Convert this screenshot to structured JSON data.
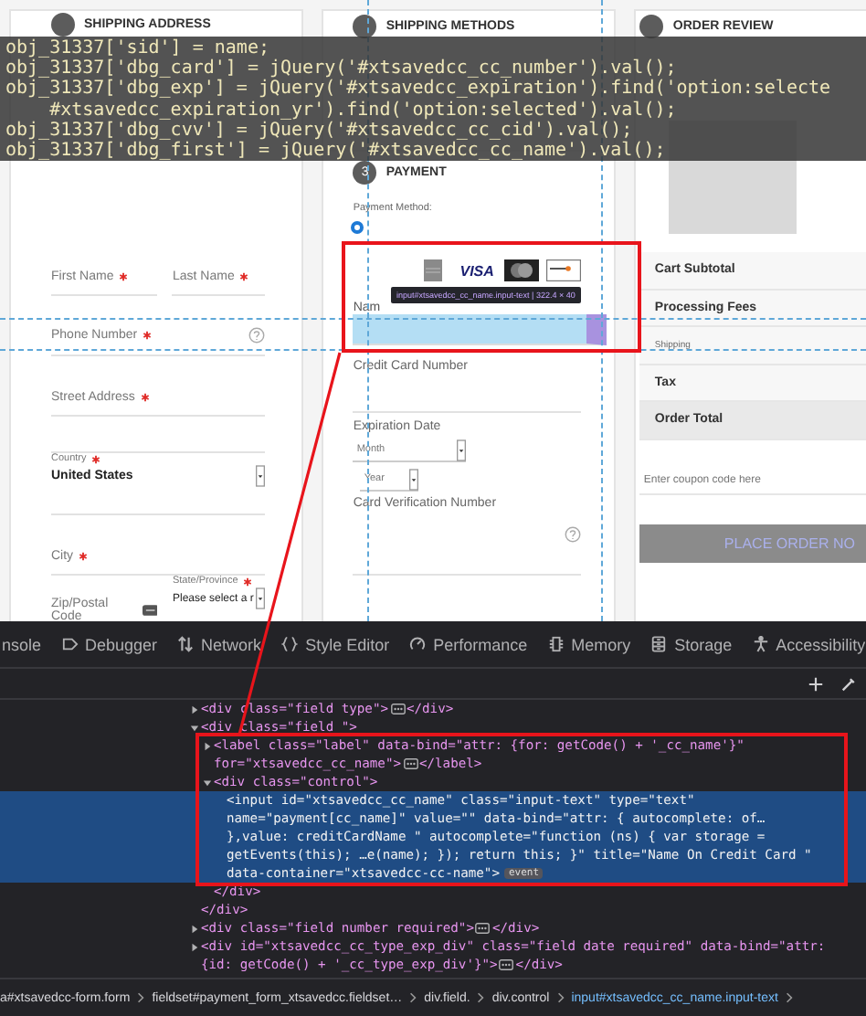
{
  "code_overlay": {
    "lines": [
      "obj_31337['sid'] = name;",
      "obj_31337['dbg_card'] = jQuery('#xtsavedcc_cc_number').val();",
      "obj_31337['dbg_exp'] = jQuery('#xtsavedcc_expiration').find('option:selecte",
      "    #xtsavedcc_expiration_yr').find('option:selected').val();",
      "obj_31337['dbg_cvv'] = jQuery('#xtsavedcc_cc_cid').val();",
      "obj_31337['dbg_first'] = jQuery('#xtsavedcc_cc_name').val();"
    ]
  },
  "shipping_address": {
    "step": {
      "title": "SHIPPING ADDRESS"
    },
    "rows": [
      [
        {
          "kind": "text",
          "label": "First Name",
          "required": true
        },
        {
          "kind": "text",
          "label": "Last Name",
          "required": true
        }
      ],
      [
        {
          "kind": "text",
          "label": "Phone Number",
          "required": true,
          "help": true
        }
      ],
      [
        {
          "kind": "text",
          "label": "Street Address",
          "required": true
        }
      ],
      [
        {
          "kind": "blank"
        }
      ],
      [
        {
          "kind": "select",
          "label": "Country",
          "required": true,
          "value": "United States"
        }
      ],
      [
        {
          "kind": "text",
          "label": "City",
          "required": true
        }
      ],
      [
        {
          "kind": "text",
          "label": "Zip/Postal Code",
          "required": false,
          "hint": true
        },
        {
          "kind": "select",
          "label": "State/Province",
          "required": true,
          "value": "Please select a r"
        }
      ]
    ]
  },
  "shipping_methods": {
    "step": {
      "title": "SHIPPING METHODS"
    }
  },
  "payment": {
    "step": {
      "number": "3",
      "title": "PAYMENT"
    },
    "method_label": "Payment Method:",
    "method_radio": {
      "selected": true
    },
    "card_logos": [
      {
        "kind": "amex"
      },
      {
        "kind": "visa",
        "text": "VISA"
      },
      {
        "kind": "mastercard"
      },
      {
        "kind": "discover"
      }
    ],
    "tooltip": "input#xtsavedcc_cc_name.input-text | 322.4 × 40",
    "name_field": {
      "label": "Nam",
      "highlighted": true
    },
    "fields": [
      {
        "kind": "text",
        "label": "Credit Card Number"
      },
      {
        "kind": "date",
        "label": "Expiration Date",
        "month": "Month",
        "year": "Year"
      },
      {
        "kind": "text",
        "label": "Card Verification Number",
        "help": true
      }
    ]
  },
  "order_review": {
    "step": {
      "title": "ORDER REVIEW"
    },
    "totals": [
      {
        "label": "Cart Subtotal",
        "kind": "bold"
      },
      {
        "label": "Processing Fees",
        "kind": "bold"
      },
      {
        "label": "Shipping",
        "kind": "small"
      },
      {
        "label": "Tax",
        "kind": "bold"
      },
      {
        "label": "Order Total",
        "kind": "total"
      }
    ],
    "coupon": {
      "placeholder": "Enter coupon code here"
    },
    "button": "PLACE ORDER NO"
  },
  "devtools": {
    "tabs": [
      {
        "label": "nsole",
        "kind": "none",
        "selected": false
      },
      {
        "label": "Debugger",
        "kind": "debugger",
        "selected": false
      },
      {
        "label": "Network",
        "kind": "network",
        "selected": false
      },
      {
        "label": "Style Editor",
        "kind": "style",
        "selected": false
      },
      {
        "label": "Performance",
        "kind": "performance",
        "selected": false
      },
      {
        "label": "Memory",
        "kind": "memory",
        "selected": false
      },
      {
        "label": "Storage",
        "kind": "storage",
        "selected": false
      },
      {
        "label": "Accessibility",
        "kind": "accessibility",
        "selected": false
      }
    ],
    "nodes": [
      {
        "lines": [
          "<div class=\"field type\">"
        ],
        "close": "</div>",
        "expanded": false,
        "selected": false
      },
      {
        "lines": [
          "<div class=\"field \">"
        ],
        "close": "</div>",
        "expanded": true,
        "selected": false,
        "children": [
          {
            "lines": [
              "<label class=\"label\" data-bind=\"attr: {for: getCode() + '_cc_name'}\"",
              "for=\"xtsavedcc_cc_name\">"
            ],
            "close": "</label>",
            "expanded": false,
            "selected": false
          },
          {
            "lines": [
              "<div class=\"control\">"
            ],
            "close": "</div>",
            "expanded": true,
            "selected": false,
            "children": [
              {
                "lines": [
                  "<input id=\"xtsavedcc_cc_name\" class=\"input-text\" type=\"text\"",
                  "name=\"payment[cc_name]\" value=\"\" data-bind=\"attr: { autocomplete: of…",
                  "},value: creditCardName \" autocomplete=\"function (ns) { var storage =",
                  "getEvents(this); …e(name); }); return this; }\" title=\"Name On Credit Card \"",
                  "data-container=\"xtsavedcc-cc-name\">"
                ],
                "badge": "event",
                "selected": true
              }
            ]
          }
        ]
      },
      {
        "lines": [
          "<div class=\"field number required\">"
        ],
        "close": "</div>",
        "expanded": false,
        "selected": false
      },
      {
        "lines": [
          "<div id=\"xtsavedcc_cc_type_exp_div\" class=\"field date required\" data-bind=\"attr:",
          "{id: getCode() + '_cc_type_exp_div'}\">"
        ],
        "close": "</div>",
        "expanded": false,
        "selected": false
      }
    ],
    "breadcrumbs": [
      {
        "label": "a#xtsavedcc-form.form",
        "selected": false
      },
      {
        "label": "fieldset#payment_form_xtsavedcc.fieldset…",
        "selected": false
      },
      {
        "label": "div.field.",
        "selected": false
      },
      {
        "label": "div.control",
        "selected": false
      },
      {
        "label": "input#xtsavedcc_cc_name.input-text",
        "selected": true
      }
    ]
  }
}
